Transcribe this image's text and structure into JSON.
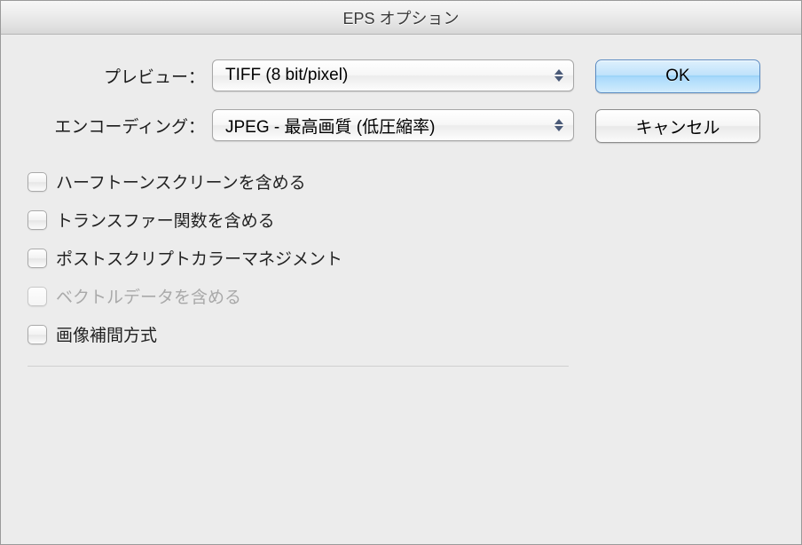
{
  "window": {
    "title": "EPS オプション"
  },
  "form": {
    "preview_label": "プレビュー：",
    "preview_value": "TIFF (8 bit/pixel)",
    "encoding_label": "エンコーディング：",
    "encoding_value": "JPEG - 最高画質 (低圧縮率)"
  },
  "checkboxes": {
    "halftone": {
      "label": "ハーフトーンスクリーンを含める",
      "checked": false,
      "enabled": true
    },
    "transfer": {
      "label": "トランスファー関数を含める",
      "checked": false,
      "enabled": true
    },
    "postscript_color": {
      "label": "ポストスクリプトカラーマネジメント",
      "checked": false,
      "enabled": true
    },
    "vector": {
      "label": "ベクトルデータを含める",
      "checked": false,
      "enabled": false
    },
    "interpolation": {
      "label": "画像補間方式",
      "checked": false,
      "enabled": true
    }
  },
  "buttons": {
    "ok": "OK",
    "cancel": "キャンセル"
  }
}
